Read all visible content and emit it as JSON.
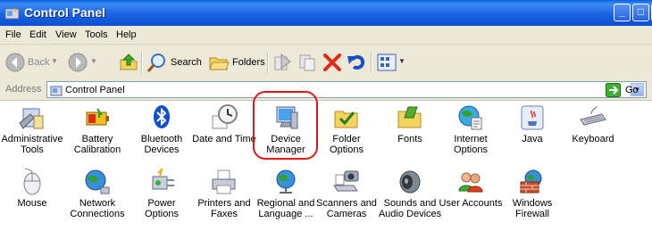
{
  "window": {
    "title": "Control Panel",
    "controls": {
      "minimize": "_",
      "maximize": "□",
      "close": "✕"
    }
  },
  "menu": [
    "File",
    "Edit",
    "View",
    "Tools",
    "Help"
  ],
  "toolbar": {
    "back_label": "Back",
    "search_label": "Search",
    "folders_label": "Folders"
  },
  "address": {
    "label": "Address",
    "value": "Control Panel",
    "go_label": "Go"
  },
  "highlight_color": "#e01818",
  "items": [
    {
      "label": "Administrative\nTools",
      "icon": "administrative-tools-icon"
    },
    {
      "label": "Battery\nCalibration",
      "icon": "battery-icon"
    },
    {
      "label": "Bluetooth\nDevices",
      "icon": "bluetooth-icon"
    },
    {
      "label": "Date and Time",
      "icon": "clock-icon"
    },
    {
      "label": "Device\nManager",
      "icon": "device-manager-icon"
    },
    {
      "label": "Folder Options",
      "icon": "folder-check-icon"
    },
    {
      "label": "Fonts",
      "icon": "fonts-folder-icon"
    },
    {
      "label": "Internet\nOptions",
      "icon": "internet-options-icon"
    },
    {
      "label": "Java",
      "icon": "java-icon"
    },
    {
      "label": "Keyboard",
      "icon": "keyboard-icon"
    },
    {
      "label": "Mouse",
      "icon": "mouse-icon"
    },
    {
      "label": "Network\nConnections",
      "icon": "network-globe-icon"
    },
    {
      "label": "Power Options",
      "icon": "power-plug-icon"
    },
    {
      "label": "Printers and\nFaxes",
      "icon": "printer-icon"
    },
    {
      "label": "Regional and\nLanguage ...",
      "icon": "globe-icon"
    },
    {
      "label": "Scanners and\nCameras",
      "icon": "scanner-camera-icon"
    },
    {
      "label": "Sounds and\nAudio Devices",
      "icon": "speaker-icon"
    },
    {
      "label": "User Accounts",
      "icon": "users-icon"
    },
    {
      "label": "Windows\nFirewall",
      "icon": "firewall-icon"
    }
  ]
}
